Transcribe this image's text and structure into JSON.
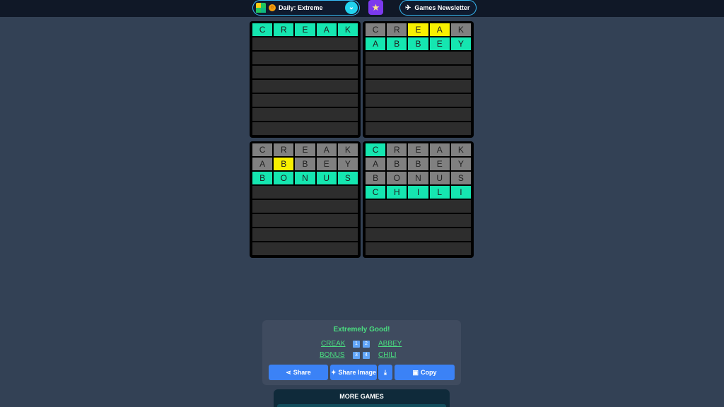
{
  "header": {
    "mode_label": "Daily: Extreme",
    "newsletter_label": "Games Newsletter",
    "icons": [
      "game-logo-icon",
      "smiley-emoji-icon",
      "chevron-down-icon",
      "star-icon",
      "rocket-icon"
    ]
  },
  "boards": [
    {
      "rows": [
        {
          "letters": [
            "C",
            "R",
            "E",
            "A",
            "K"
          ],
          "states": [
            "c",
            "c",
            "c",
            "c",
            "c"
          ]
        }
      ],
      "empty_rows": 7
    },
    {
      "rows": [
        {
          "letters": [
            "C",
            "R",
            "E",
            "A",
            "K"
          ],
          "states": [
            "g",
            "g",
            "y",
            "y",
            "g"
          ]
        },
        {
          "letters": [
            "A",
            "B",
            "B",
            "E",
            "Y"
          ],
          "states": [
            "c",
            "c",
            "c",
            "c",
            "c"
          ]
        }
      ],
      "empty_rows": 6
    },
    {
      "rows": [
        {
          "letters": [
            "C",
            "R",
            "E",
            "A",
            "K"
          ],
          "states": [
            "g",
            "g",
            "g",
            "g",
            "g"
          ]
        },
        {
          "letters": [
            "A",
            "B",
            "B",
            "E",
            "Y"
          ],
          "states": [
            "g",
            "y",
            "g",
            "g",
            "g"
          ]
        },
        {
          "letters": [
            "B",
            "O",
            "N",
            "U",
            "S"
          ],
          "states": [
            "c",
            "c",
            "c",
            "c",
            "c"
          ]
        }
      ],
      "empty_rows": 5
    },
    {
      "rows": [
        {
          "letters": [
            "C",
            "R",
            "E",
            "A",
            "K"
          ],
          "states": [
            "c",
            "g",
            "g",
            "g",
            "g"
          ]
        },
        {
          "letters": [
            "A",
            "B",
            "B",
            "E",
            "Y"
          ],
          "states": [
            "g",
            "g",
            "g",
            "g",
            "g"
          ]
        },
        {
          "letters": [
            "B",
            "O",
            "N",
            "U",
            "S"
          ],
          "states": [
            "g",
            "g",
            "g",
            "g",
            "g"
          ]
        },
        {
          "letters": [
            "C",
            "H",
            "I",
            "L",
            "I"
          ],
          "states": [
            "c",
            "c",
            "c",
            "c",
            "c"
          ]
        }
      ],
      "empty_rows": 4
    }
  ],
  "colors": {
    "correct": "#15e6b0",
    "present": "#f8f000",
    "absent": "#808080"
  },
  "result": {
    "title": "Extremely Good!",
    "words": [
      "CREAK",
      "ABBEY",
      "BONUS",
      "CHILI"
    ],
    "scores": [
      "1",
      "2",
      "3",
      "4"
    ],
    "share_label": "Share",
    "share_image_label": "Share Image",
    "copy_label": "Copy"
  },
  "more_games_label": "MORE GAMES"
}
